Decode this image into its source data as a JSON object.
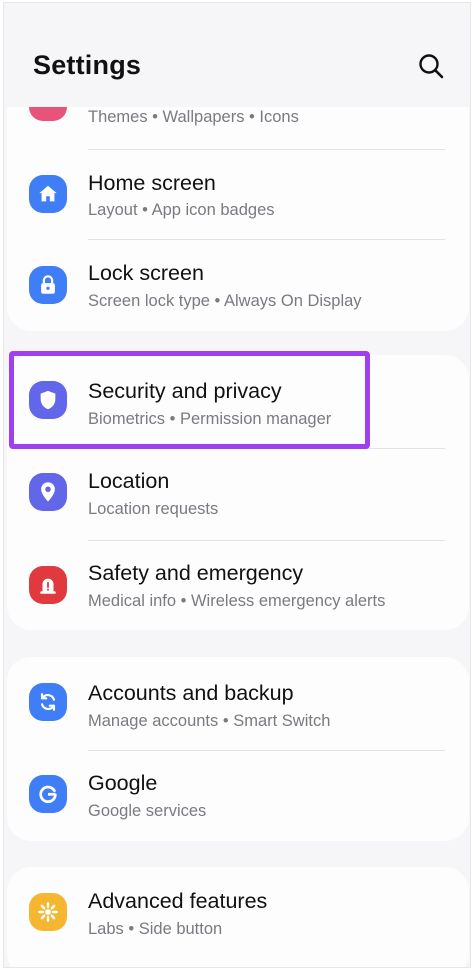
{
  "header": {
    "title": "Settings"
  },
  "colors": {
    "highlight": "#a13ef0",
    "blue_icon": "#3f7ef6",
    "indigo_icon": "#6167e8",
    "red_icon": "#e0393e",
    "pink_icon": "#e8537a",
    "yellow_icon": "#f5b731"
  },
  "groups": [
    {
      "items": [
        {
          "icon": "themes-icon",
          "title": "",
          "subtitle": "Themes  •  Wallpapers  •  Icons"
        },
        {
          "icon": "home-icon",
          "title": "Home screen",
          "subtitle": "Layout  •  App icon badges"
        },
        {
          "icon": "lock-icon",
          "title": "Lock screen",
          "subtitle": "Screen lock type  •  Always On Display"
        }
      ]
    },
    {
      "items": [
        {
          "icon": "shield-icon",
          "title": "Security and privacy",
          "subtitle": "Biometrics  •  Permission manager"
        },
        {
          "icon": "location-pin-icon",
          "title": "Location",
          "subtitle": "Location requests"
        },
        {
          "icon": "emergency-alert-icon",
          "title": "Safety and emergency",
          "subtitle": "Medical info  •  Wireless emergency alerts"
        }
      ]
    },
    {
      "items": [
        {
          "icon": "sync-icon",
          "title": "Accounts and backup",
          "subtitle": "Manage accounts  •  Smart Switch"
        },
        {
          "icon": "google-icon",
          "title": "Google",
          "subtitle": "Google services"
        }
      ]
    },
    {
      "items": [
        {
          "icon": "advanced-features-icon",
          "title": "Advanced features",
          "subtitle": "Labs  •  Side button"
        }
      ]
    }
  ]
}
